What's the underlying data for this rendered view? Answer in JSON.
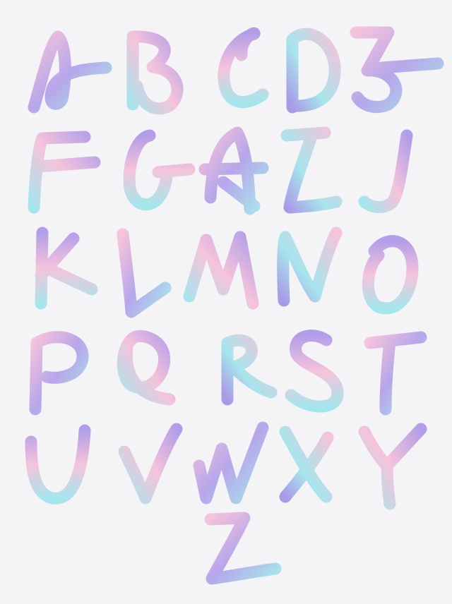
{
  "letters": [
    "A",
    "B",
    "C",
    "D",
    "E",
    "F",
    "G",
    "H",
    "I",
    "J",
    "K",
    "L",
    "M",
    "N",
    "O",
    "P",
    "Q",
    "R",
    "S",
    "T",
    "U",
    "V",
    "W",
    "X",
    "Y",
    "Z"
  ],
  "colors": {
    "background": "#f4f3f5",
    "pink": "#f4c4dc",
    "lavender": "#a99ae6",
    "mint": "#a8e6ec"
  }
}
